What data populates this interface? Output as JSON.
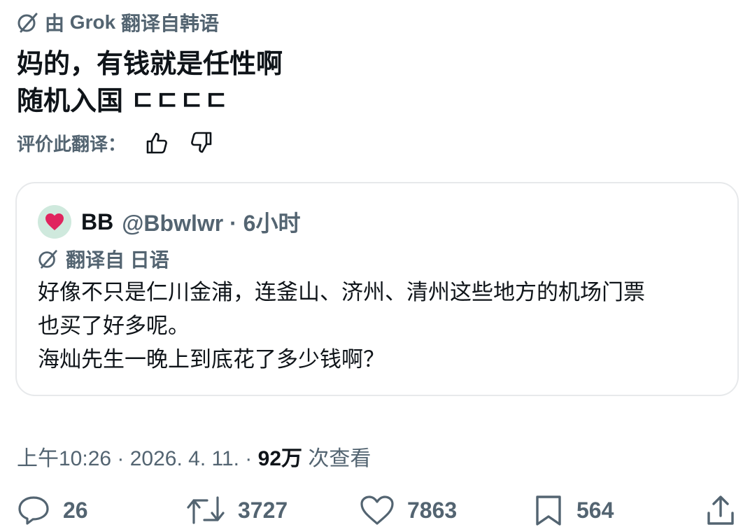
{
  "translation_note": {
    "prefix": "由",
    "brand": "Grok",
    "suffix": "翻译自韩语"
  },
  "tweet": {
    "text": "妈的，有钱就是任性啊\n随机入国 ㄷㄷㄷㄷ"
  },
  "rate": {
    "label": "评价此翻译："
  },
  "quote": {
    "avatar_icon": "heart-icon",
    "name": "BB",
    "handle_time": "@Bbwlwr · 6小时",
    "translation_label": "翻译自 日语",
    "text": "好像不只是仁川金浦，连釜山、济州、清州这些地方的机场门票\n也买了好多呢。\n海灿先生一晚上到底花了多少钱啊？"
  },
  "meta": {
    "datetime": "上午10:26 · 2026. 4. 11. · ",
    "views_count": "92万",
    "views_label": " 次查看"
  },
  "actions": {
    "replies": "26",
    "retweets": "3727",
    "likes": "7863",
    "bookmarks": "564"
  },
  "colors": {
    "text": "#0f1419",
    "muted": "#536471",
    "border": "#e7e9eb",
    "avatar_bg": "#cfe9dd",
    "heart": "#e0245e"
  }
}
